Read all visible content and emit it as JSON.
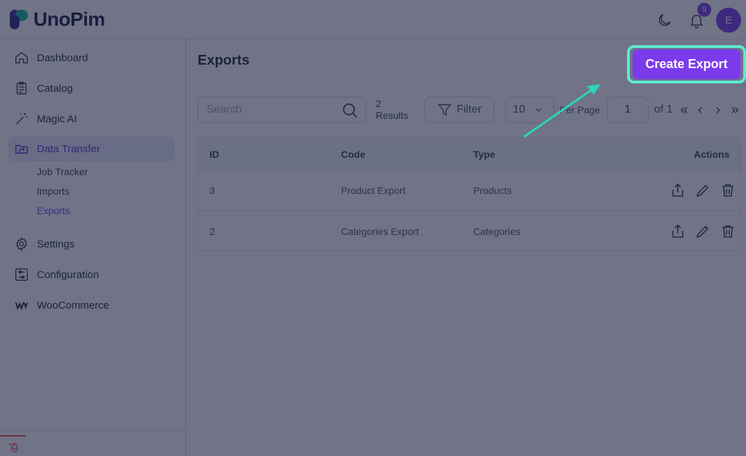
{
  "header": {
    "logo_text": "UnoPim",
    "notification_count": "9",
    "avatar_initial": "E"
  },
  "sidebar": {
    "items": [
      {
        "label": "Dashboard",
        "icon": "home-icon"
      },
      {
        "label": "Catalog",
        "icon": "clipboard-icon"
      },
      {
        "label": "Magic AI",
        "icon": "magic-wand-icon"
      },
      {
        "label": "Data Transfer",
        "icon": "transfer-icon"
      },
      {
        "label": "Settings",
        "icon": "gear-icon"
      },
      {
        "label": "Configuration",
        "icon": "sliders-icon"
      },
      {
        "label": "WooCommerce",
        "icon": "woocommerce-icon"
      }
    ],
    "subitems": [
      "Job Tracker",
      "Imports",
      "Exports"
    ],
    "active_item": "Data Transfer",
    "active_subitem": "Exports"
  },
  "main": {
    "title": "Exports",
    "create_button": "Create Export",
    "search_placeholder": "Search",
    "results_count": "2",
    "results_label": "Results",
    "filter_label": "Filter",
    "per_page_value": "10",
    "per_page_label": "Per Page",
    "page_value": "1",
    "page_of": "of 1"
  },
  "table": {
    "headers": {
      "id": "ID",
      "code": "Code",
      "type": "Type",
      "actions": "Actions"
    },
    "rows": [
      {
        "id": "3",
        "code": "Product Export",
        "type": "Products"
      },
      {
        "id": "2",
        "code": "Categories Export",
        "type": "Categories"
      }
    ]
  },
  "colors": {
    "accent": "#7c3aed",
    "highlight": "#5eead4",
    "overlay": "rgba(25,30,60,0.62)"
  }
}
